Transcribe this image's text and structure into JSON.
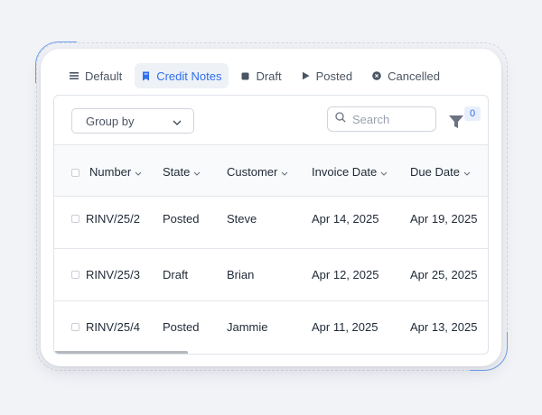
{
  "tabs": [
    {
      "label": "Default",
      "icon": "list-icon",
      "active": false
    },
    {
      "label": "Credit Notes",
      "icon": "bookmark-icon",
      "active": true
    },
    {
      "label": "Draft",
      "icon": "square-icon",
      "active": false
    },
    {
      "label": "Posted",
      "icon": "play-icon",
      "active": false
    },
    {
      "label": "Cancelled",
      "icon": "x-circle-icon",
      "active": false
    }
  ],
  "toolbar": {
    "group_by_label": "Group by",
    "search_placeholder": "Search",
    "filter_count": "0"
  },
  "table": {
    "columns": [
      "Number",
      "State",
      "Customer",
      "Invoice Date",
      "Due Date"
    ],
    "rows": [
      {
        "number": "RINV/25/2",
        "state": "Posted",
        "customer": "Steve",
        "invoice_date": "Apr 14, 2025",
        "due_date": "Apr 19, 2025"
      },
      {
        "number": "RINV/25/3",
        "state": "Draft",
        "customer": "Brian",
        "invoice_date": "Apr 12, 2025",
        "due_date": "Apr 25, 2025"
      },
      {
        "number": "RINV/25/4",
        "state": "Posted",
        "customer": "Jammie",
        "invoice_date": "Apr 11, 2025",
        "due_date": "Apr 13, 2025"
      }
    ]
  },
  "colors": {
    "accent": "#2f6fed",
    "active_tab_bg": "#eef1f6",
    "frame_accent": "#6ea2ee"
  }
}
